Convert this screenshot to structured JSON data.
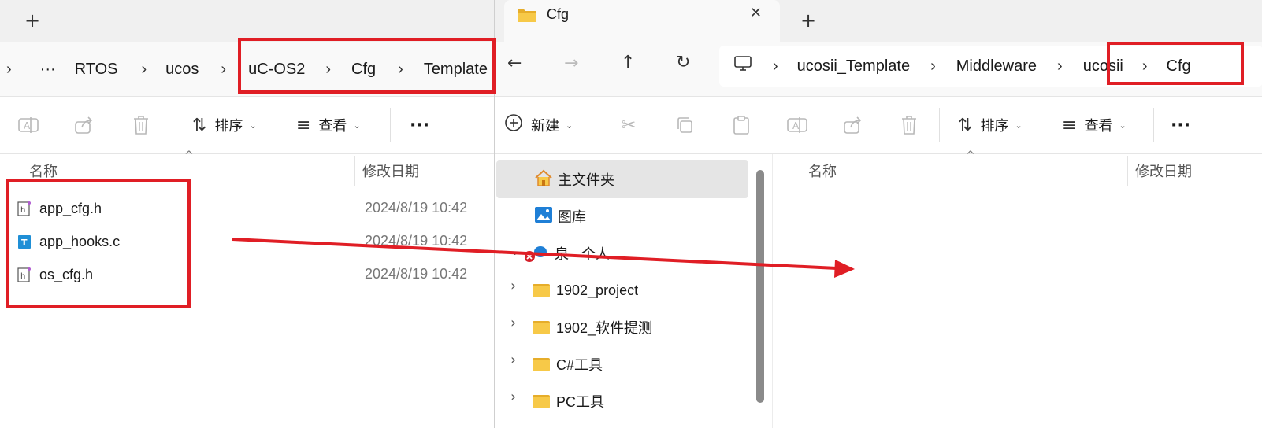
{
  "left": {
    "new_tab": "+",
    "breadcrumb": [
      "›",
      "···",
      "RTOS",
      "ucos",
      "uC-OS2",
      "Cfg",
      "Template"
    ],
    "toolbar": {
      "sort_label": "排序",
      "view_label": "查看",
      "more": "···"
    },
    "columns": {
      "name": "名称",
      "modified": "修改日期"
    },
    "files": [
      {
        "name": "app_cfg.h",
        "date": "2024/8/19 10:42",
        "icon": "header-file-icon"
      },
      {
        "name": "app_hooks.c",
        "date": "2024/8/19 10:42",
        "icon": "c-file-icon"
      },
      {
        "name": "os_cfg.h",
        "date": "2024/8/19 10:42",
        "icon": "header-file-icon"
      }
    ]
  },
  "right": {
    "tab_title": "Cfg",
    "tab_close": "✕",
    "new_tab": "+",
    "breadcrumb": [
      "ucosii_Template",
      "Middleware",
      "ucosii",
      "Cfg"
    ],
    "toolbar": {
      "new_label": "新建",
      "sort_label": "排序",
      "view_label": "查看",
      "more": "···"
    },
    "columns": {
      "name": "名称",
      "modified": "修改日期"
    },
    "nav": [
      {
        "label": "主文件夹",
        "icon": "home-icon"
      },
      {
        "label": "图库",
        "icon": "gallery-icon"
      },
      {
        "label": "泉 - 个人",
        "icon": "cloud-icon"
      },
      {
        "label": "1902_project",
        "icon": "folder-icon"
      },
      {
        "label": "1902_软件提测",
        "icon": "folder-icon"
      },
      {
        "label": "C#工具",
        "icon": "folder-icon"
      },
      {
        "label": "PC工具",
        "icon": "folder-icon"
      }
    ]
  },
  "colors": {
    "highlight": "#e01e25",
    "folder": "#f7c948",
    "selected_nav": "#e5e5e5"
  }
}
